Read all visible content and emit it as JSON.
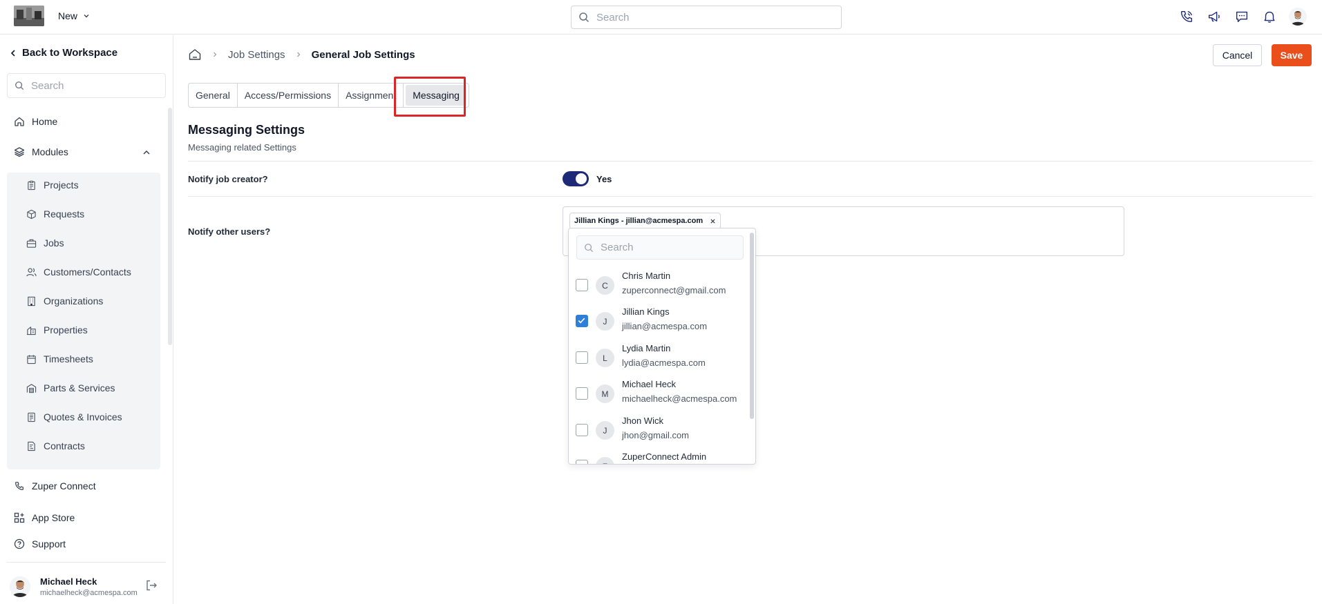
{
  "topbar": {
    "new_label": "New",
    "search_placeholder": "Search"
  },
  "sidebar": {
    "back_label": "Back to Workspace",
    "search_placeholder": "Search",
    "home_label": "Home",
    "modules_label": "Modules",
    "modules": [
      {
        "label": "Projects",
        "icon": "clipboard-icon"
      },
      {
        "label": "Requests",
        "icon": "box-icon"
      },
      {
        "label": "Jobs",
        "icon": "briefcase-icon"
      },
      {
        "label": "Customers/Contacts",
        "icon": "users-icon"
      },
      {
        "label": "Organizations",
        "icon": "building-icon"
      },
      {
        "label": "Properties",
        "icon": "property-icon"
      },
      {
        "label": "Timesheets",
        "icon": "calendar-icon"
      },
      {
        "label": "Parts & Services",
        "icon": "warehouse-icon"
      },
      {
        "label": "Quotes & Invoices",
        "icon": "invoice-icon"
      },
      {
        "label": "Contracts",
        "icon": "contract-icon"
      }
    ],
    "zuper_connect_label": "Zuper Connect",
    "app_store_label": "App Store",
    "support_label": "Support",
    "user": {
      "name": "Michael Heck",
      "email": "michaelheck@acmespa.com"
    }
  },
  "breadcrumb": {
    "level1": "Job Settings",
    "current": "General Job Settings"
  },
  "actions": {
    "cancel_label": "Cancel",
    "save_label": "Save"
  },
  "tabs": [
    {
      "label": "General",
      "active": false
    },
    {
      "label": "Access/Permissions",
      "active": false
    },
    {
      "label": "Assignment",
      "active": false
    },
    {
      "label": "Messaging",
      "active": true
    }
  ],
  "section": {
    "title": "Messaging Settings",
    "subtitle": "Messaging related Settings"
  },
  "notify_creator": {
    "label": "Notify job creator?",
    "value_label": "Yes",
    "enabled": true
  },
  "notify_others": {
    "label": "Notify other users?",
    "selected_chip": "Jillian Kings - jillian@acmespa.com"
  },
  "dropdown": {
    "search_placeholder": "Search",
    "users": [
      {
        "initial": "C",
        "name": "Chris Martin",
        "email": "zuperconnect@gmail.com",
        "checked": false
      },
      {
        "initial": "J",
        "name": "Jillian Kings",
        "email": "jillian@acmespa.com",
        "checked": true
      },
      {
        "initial": "L",
        "name": "Lydia Martin",
        "email": "lydia@acmespa.com",
        "checked": false
      },
      {
        "initial": "M",
        "name": "Michael Heck",
        "email": "michaelheck@acmespa.com",
        "checked": false
      },
      {
        "initial": "J",
        "name": "Jhon Wick",
        "email": "jhon@gmail.com",
        "checked": false
      },
      {
        "initial": "Z",
        "name": "ZuperConnect Admin",
        "email": "",
        "checked": false
      }
    ]
  },
  "colors": {
    "accent": "#e94e1b",
    "toggle": "#1e2a78",
    "checkbox": "#2f7fd9",
    "highlight": "#dc2626"
  }
}
